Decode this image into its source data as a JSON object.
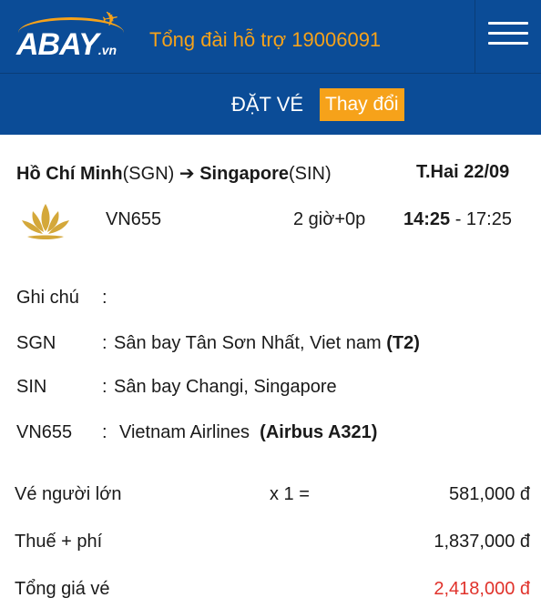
{
  "header": {
    "logo_text": "ABAY",
    "logo_suffix": ".vn",
    "hotline": "Tổng đài hỗ trợ 19006091",
    "menu_icon": "hamburger-menu-icon"
  },
  "subheader": {
    "title": "ĐẶT VÉ",
    "change_button": "Thay đổi"
  },
  "trip": {
    "from_city": "Hồ Chí Minh",
    "from_code": "(SGN)",
    "arrow": "➔",
    "to_city": "Singapore",
    "to_code": "(SIN)",
    "date": "T.Hai 22/09"
  },
  "flight": {
    "airline_logo": "vietnam-airlines-lotus-logo",
    "number": "VN655",
    "duration": "2 giờ+0p",
    "depart": "14:25",
    "arrive": "- 17:25"
  },
  "details": {
    "note_label": "Ghi chú",
    "note_colon": ":",
    "origin_code": "SGN",
    "origin_colon": ":",
    "origin_airport": "Sân bay Tân Sơn Nhất, Viet nam",
    "origin_terminal": "(T2)",
    "dest_code": "SIN",
    "dest_colon": ":",
    "dest_airport": "Sân bay Changi, Singapore",
    "flight_code": "VN655",
    "flight_colon": ":",
    "airline": "Vietnam Airlines",
    "aircraft": "(Airbus A321)"
  },
  "pricing": {
    "adult_label": "Vé người lớn",
    "adult_mult": "x 1 =",
    "adult_price": "581,000 đ",
    "tax_label": "Thuế + phí",
    "tax_price": "1,837,000 đ",
    "total_label": "Tổng giá vé",
    "total_price": "2,418,000 đ",
    "total_color": "#e0322b"
  },
  "colors": {
    "header_bg": "#0b4c97",
    "accent": "#f6a21a"
  }
}
